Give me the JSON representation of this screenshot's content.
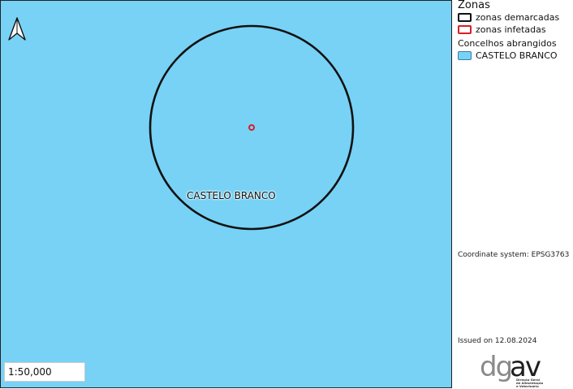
{
  "map": {
    "background_color": "#77d2f5",
    "region_label": "CASTELO BRANCO",
    "scale": "1:50,000",
    "north_arrow_icon": "north-arrow-icon"
  },
  "legend": {
    "title": "Zonas",
    "items": [
      {
        "label": "zonas demarcadas",
        "color": "#111111"
      },
      {
        "label": "zonas infetadas",
        "color": "#d81f2a"
      }
    ],
    "subtitle": "Concelhos abrangidos",
    "municipality": {
      "label": "CASTELO BRANCO",
      "color": "#77d2f5"
    }
  },
  "coordinate_system": "Coordinate system: EPSG3763",
  "issued": "Issued on 12.08.2024",
  "logo": {
    "name": "dgav",
    "tagline_lines": [
      "Direção Geral",
      "de Alimentação",
      "e Veterinária"
    ],
    "colors": {
      "dg": "#8a8a8a",
      "av": "#1e1e1e"
    }
  }
}
